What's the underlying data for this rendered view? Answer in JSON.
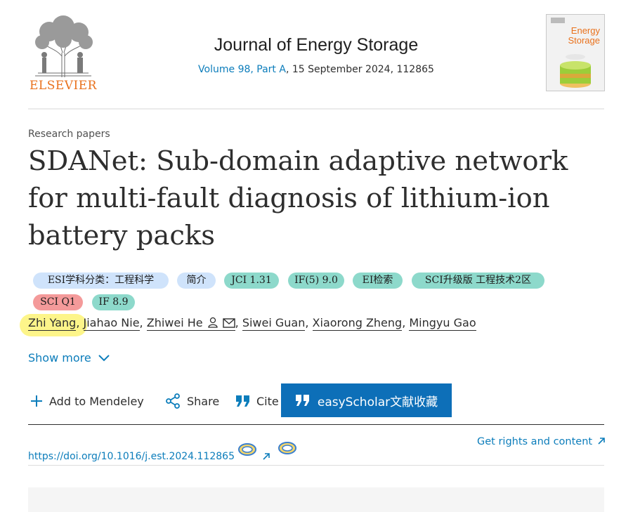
{
  "publisher": {
    "name": "ELSEVIER",
    "accent_color": "#e9711c"
  },
  "journal": {
    "title": "Journal of Energy Storage",
    "volume_link": "Volume 98, Part A",
    "volume_rest": ", 15 September 2024, 112865",
    "cover_title_line1": "Energy",
    "cover_title_line2": "Storage"
  },
  "article": {
    "type": "Research papers",
    "title": "SDANet: Sub-domain adaptive network for multi-fault diagnosis of lithium-ion battery packs"
  },
  "tags": [
    {
      "label": "ESI学科分类：工程科学",
      "color": "#cfe3fb"
    },
    {
      "label": "简介",
      "color": "#cfe3fb"
    },
    {
      "label": "JCI 1.31",
      "color": "#8dd9cb"
    },
    {
      "label": "IF(5) 9.0",
      "color": "#8dd9cb"
    },
    {
      "label": "EI检索",
      "color": "#8dd9cb"
    },
    {
      "label": "SCI升级版 工程技术2区",
      "color": "#8dd9cb"
    },
    {
      "label": "SCI Q1",
      "color": "#f49a9a"
    },
    {
      "label": "IF 8.9",
      "color": "#8dd9cb"
    }
  ],
  "authors": [
    {
      "name": "Zhi Yang",
      "highlighted": true
    },
    {
      "name": "Jiahao Nie"
    },
    {
      "name": "Zhiwei He",
      "icons": [
        "person-icon",
        "envelope-icon"
      ]
    },
    {
      "name": "Siwei Guan"
    },
    {
      "name": "Xiaorong Zheng"
    },
    {
      "name": "Mingyu Gao"
    }
  ],
  "author_sep": ",",
  "show_more": "Show more",
  "toolbar": {
    "mendeley": "Add to Mendeley",
    "share": "Share",
    "cite": "Cite",
    "easyscholar": "easyScholar文献收藏"
  },
  "doi": "https://doi.org/10.1016/j.est.2024.112865",
  "rights": "Get rights and content"
}
